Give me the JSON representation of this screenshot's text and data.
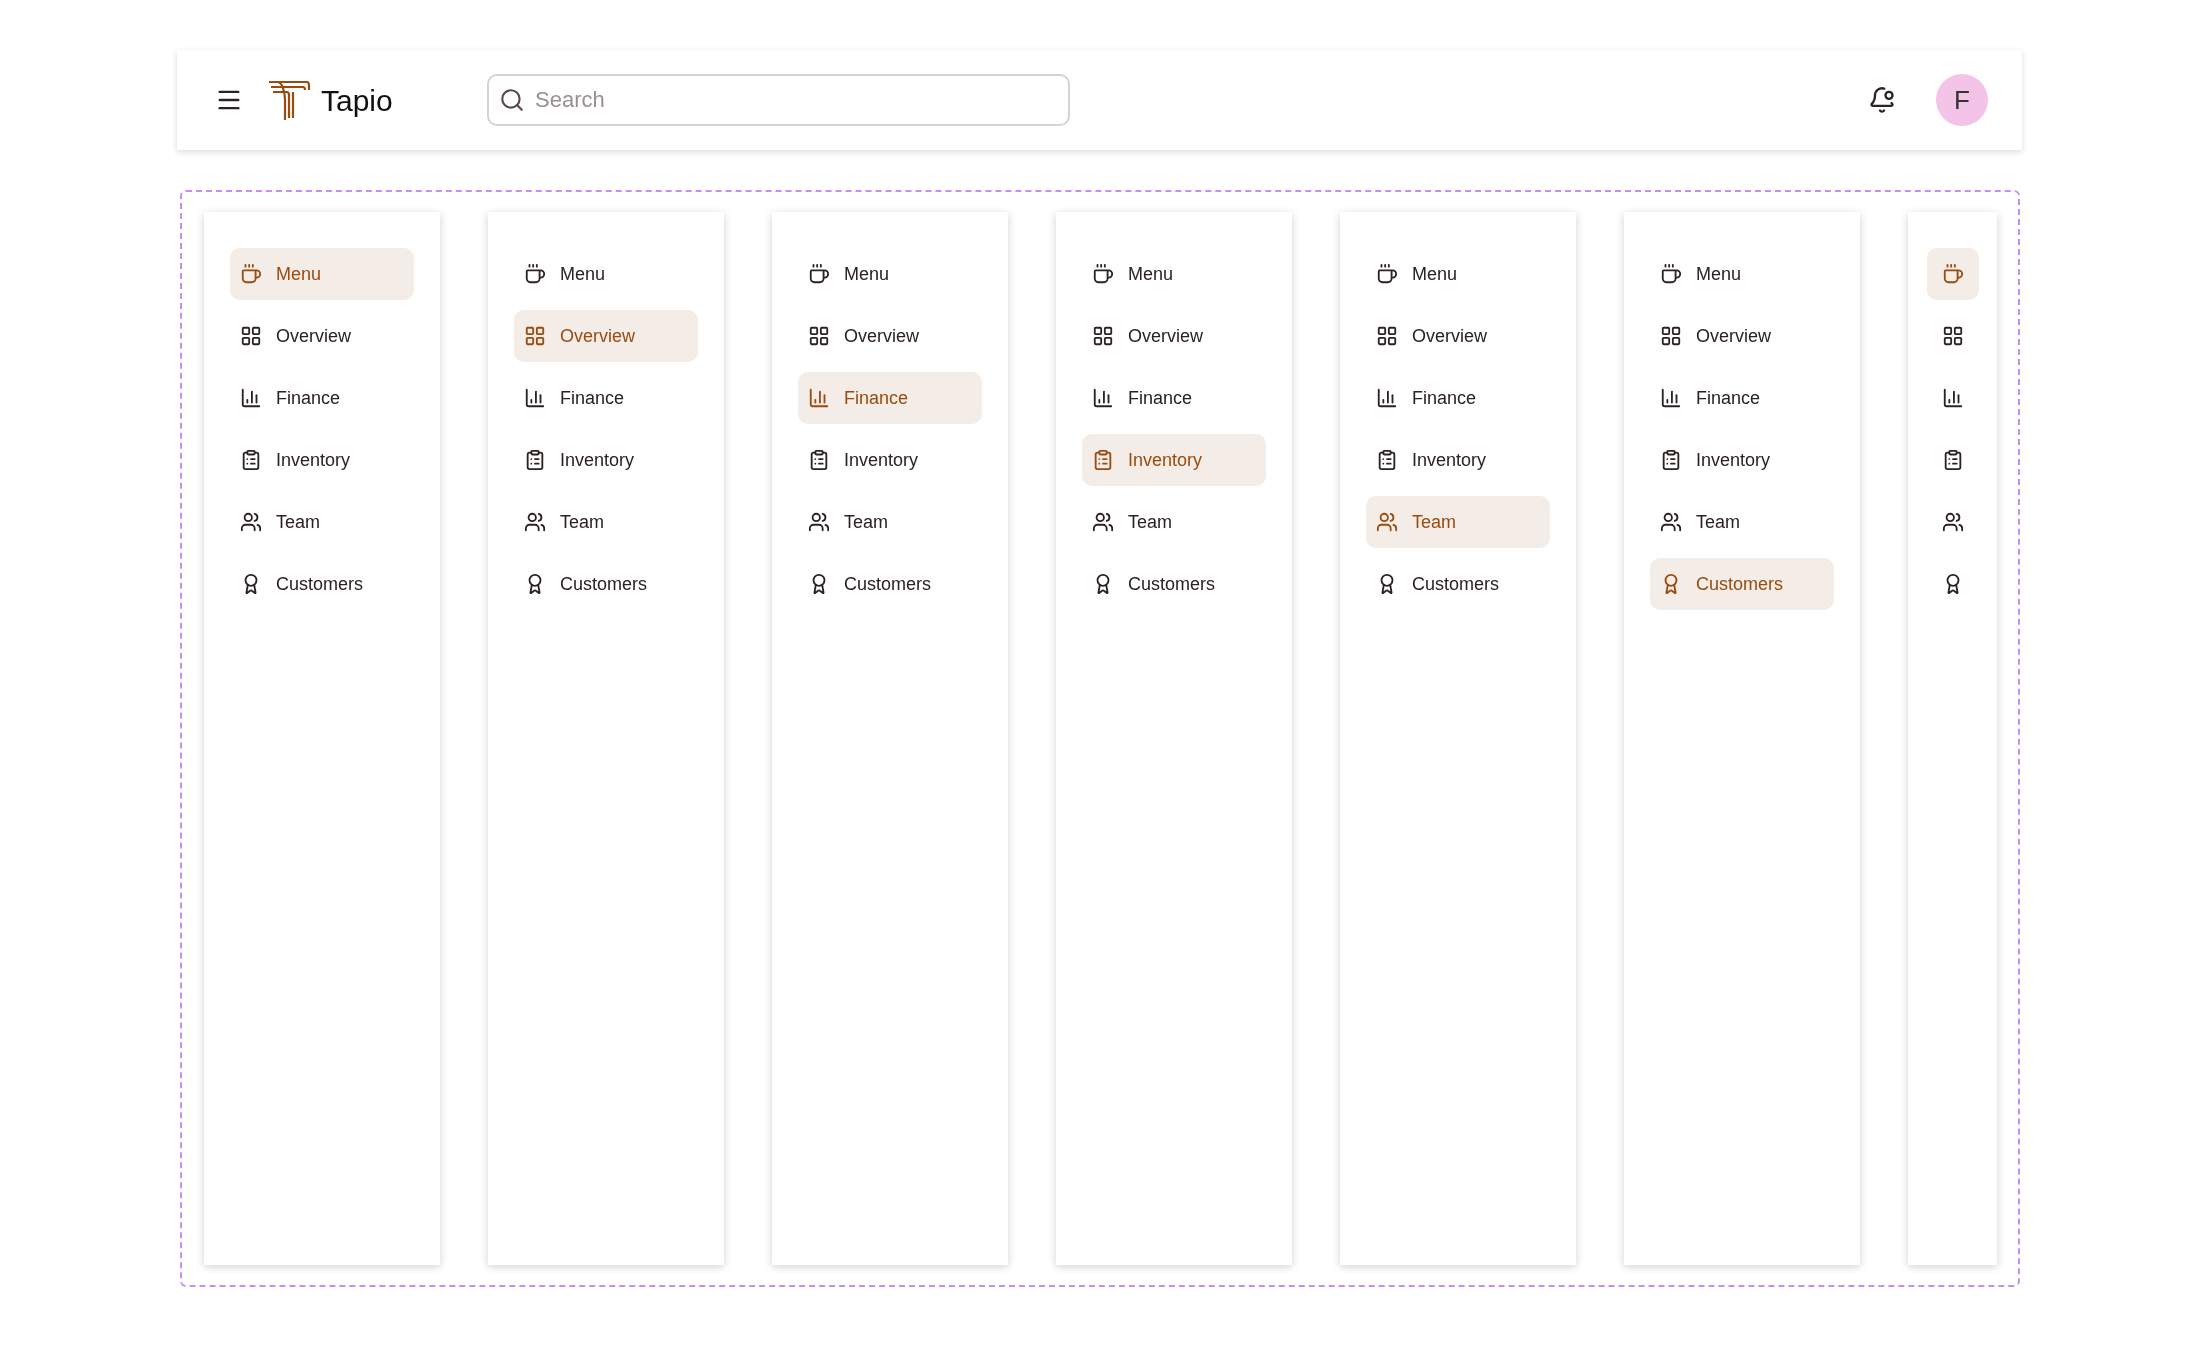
{
  "header": {
    "brand": "Tapio",
    "search": {
      "placeholder": "Search"
    },
    "notifications": {
      "unread": true
    },
    "avatar": {
      "initial": "F"
    }
  },
  "sidebars": [
    {
      "kind": "expanded",
      "items": [
        {
          "label": "Menu",
          "selected": true
        },
        {
          "label": "Overview",
          "selected": false
        },
        {
          "label": "Finance",
          "selected": false
        },
        {
          "label": "Inventory",
          "selected": false
        },
        {
          "label": "Team",
          "selected": false
        },
        {
          "label": "Customers",
          "selected": false
        }
      ]
    },
    {
      "kind": "expanded",
      "items": [
        {
          "label": "Menu",
          "selected": false
        },
        {
          "label": "Overview",
          "selected": true
        },
        {
          "label": "Finance",
          "selected": false
        },
        {
          "label": "Inventory",
          "selected": false
        },
        {
          "label": "Team",
          "selected": false
        },
        {
          "label": "Customers",
          "selected": false
        }
      ]
    },
    {
      "kind": "expanded",
      "items": [
        {
          "label": "Menu",
          "selected": false
        },
        {
          "label": "Overview",
          "selected": false
        },
        {
          "label": "Finance",
          "selected": true
        },
        {
          "label": "Inventory",
          "selected": false
        },
        {
          "label": "Team",
          "selected": false
        },
        {
          "label": "Customers",
          "selected": false
        }
      ]
    },
    {
      "kind": "expanded",
      "items": [
        {
          "label": "Menu",
          "selected": false
        },
        {
          "label": "Overview",
          "selected": false
        },
        {
          "label": "Finance",
          "selected": false
        },
        {
          "label": "Inventory",
          "selected": true
        },
        {
          "label": "Team",
          "selected": false
        },
        {
          "label": "Customers",
          "selected": false
        }
      ]
    },
    {
      "kind": "expanded",
      "items": [
        {
          "label": "Menu",
          "selected": false
        },
        {
          "label": "Overview",
          "selected": false
        },
        {
          "label": "Finance",
          "selected": false
        },
        {
          "label": "Inventory",
          "selected": false
        },
        {
          "label": "Team",
          "selected": true
        },
        {
          "label": "Customers",
          "selected": false
        }
      ]
    },
    {
      "kind": "expanded",
      "items": [
        {
          "label": "Menu",
          "selected": false
        },
        {
          "label": "Overview",
          "selected": false
        },
        {
          "label": "Finance",
          "selected": false
        },
        {
          "label": "Inventory",
          "selected": false
        },
        {
          "label": "Team",
          "selected": false
        },
        {
          "label": "Customers",
          "selected": true
        }
      ]
    },
    {
      "kind": "collapsed",
      "items": [
        {
          "selected": true
        },
        {
          "selected": false
        },
        {
          "selected": false
        },
        {
          "selected": false
        },
        {
          "selected": false
        },
        {
          "selected": false
        }
      ]
    }
  ]
}
